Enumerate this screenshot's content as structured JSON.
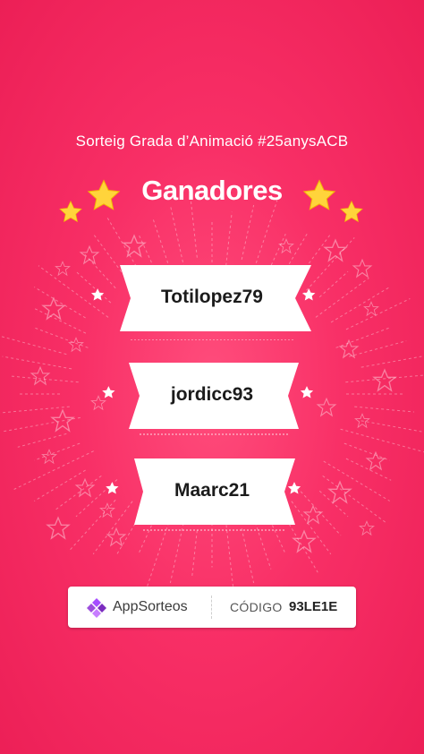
{
  "raffle": {
    "subtitle": "Sorteig Grada d’Animació #25anysACB",
    "title": "Ganadores"
  },
  "winners": [
    {
      "name": "Totilopez79"
    },
    {
      "name": "jordicc93"
    },
    {
      "name": "Maarc21"
    }
  ],
  "footer": {
    "brand": "AppSorteos",
    "code_label": "CÓDIGO",
    "code_value": "93LE1E"
  },
  "colors": {
    "background": "#f2285f",
    "star": "#ffd43b",
    "banner": "#ffffff",
    "brand_purple": "#8a2be2"
  },
  "icons": {
    "logo": "appsorteos-logo-icon",
    "decor": "star-icon"
  }
}
